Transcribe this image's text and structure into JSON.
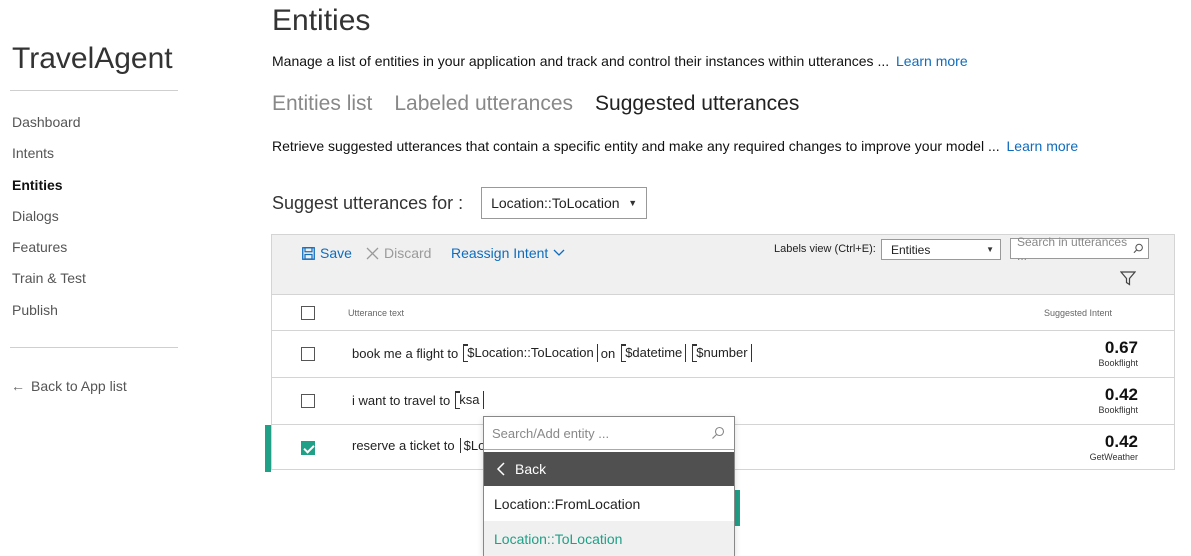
{
  "app": {
    "title": "TravelAgent"
  },
  "sidebar": {
    "items": [
      {
        "label": "Dashboard"
      },
      {
        "label": "Intents"
      },
      {
        "label": "Entities"
      },
      {
        "label": "Dialogs"
      },
      {
        "label": "Features"
      },
      {
        "label": "Train & Test"
      },
      {
        "label": "Publish"
      }
    ],
    "active": "Entities",
    "back_label": "Back to App list"
  },
  "page": {
    "title": "Entities",
    "description": "Manage a list of entities in your application and track and control their instances within utterances ...",
    "learn_more": "Learn more"
  },
  "tabs": [
    {
      "label": "Entities list"
    },
    {
      "label": "Labeled utterances"
    },
    {
      "label": "Suggested utterances"
    }
  ],
  "active_tab": "Suggested utterances",
  "suggested": {
    "description": "Retrieve suggested utterances that contain a specific entity and make any required changes to improve your model ...",
    "learn_more": "Learn more",
    "suggest_label": "Suggest utterances for :",
    "suggest_value": "Location::ToLocation"
  },
  "toolbar": {
    "save": "Save",
    "discard": "Discard",
    "reassign": "Reassign Intent",
    "labels_view_label": "Labels view (Ctrl+E):",
    "labels_view_value": "Entities",
    "search_placeholder": "Search in utterances ..."
  },
  "table": {
    "col_utterance": "Utterance text",
    "col_intent": "Suggested Intent",
    "rows": [
      {
        "pre": "book me a flight to",
        "ent1": "$Location::ToLocation",
        "mid": "on",
        "ent2": "$datetime",
        "ent3": "$number",
        "score": "0.67",
        "intent": "Bookflight",
        "checked": false
      },
      {
        "pre": "i want to travel to",
        "ent1": "ksa",
        "score": "0.42",
        "intent": "Bookflight",
        "checked": false
      },
      {
        "pre": "reserve a ticket to",
        "ent1": "$Lo",
        "score": "0.42",
        "intent": "GetWeather",
        "checked": true
      }
    ]
  },
  "popup": {
    "search_placeholder": "Search/Add entity ...",
    "back": "Back",
    "items": [
      {
        "label": "Location::FromLocation"
      },
      {
        "label": "Location::ToLocation"
      }
    ],
    "selected": "Location::ToLocation"
  },
  "colors": {
    "accent": "#20a087",
    "link": "#0f6cbd",
    "popup_header": "#505050"
  }
}
